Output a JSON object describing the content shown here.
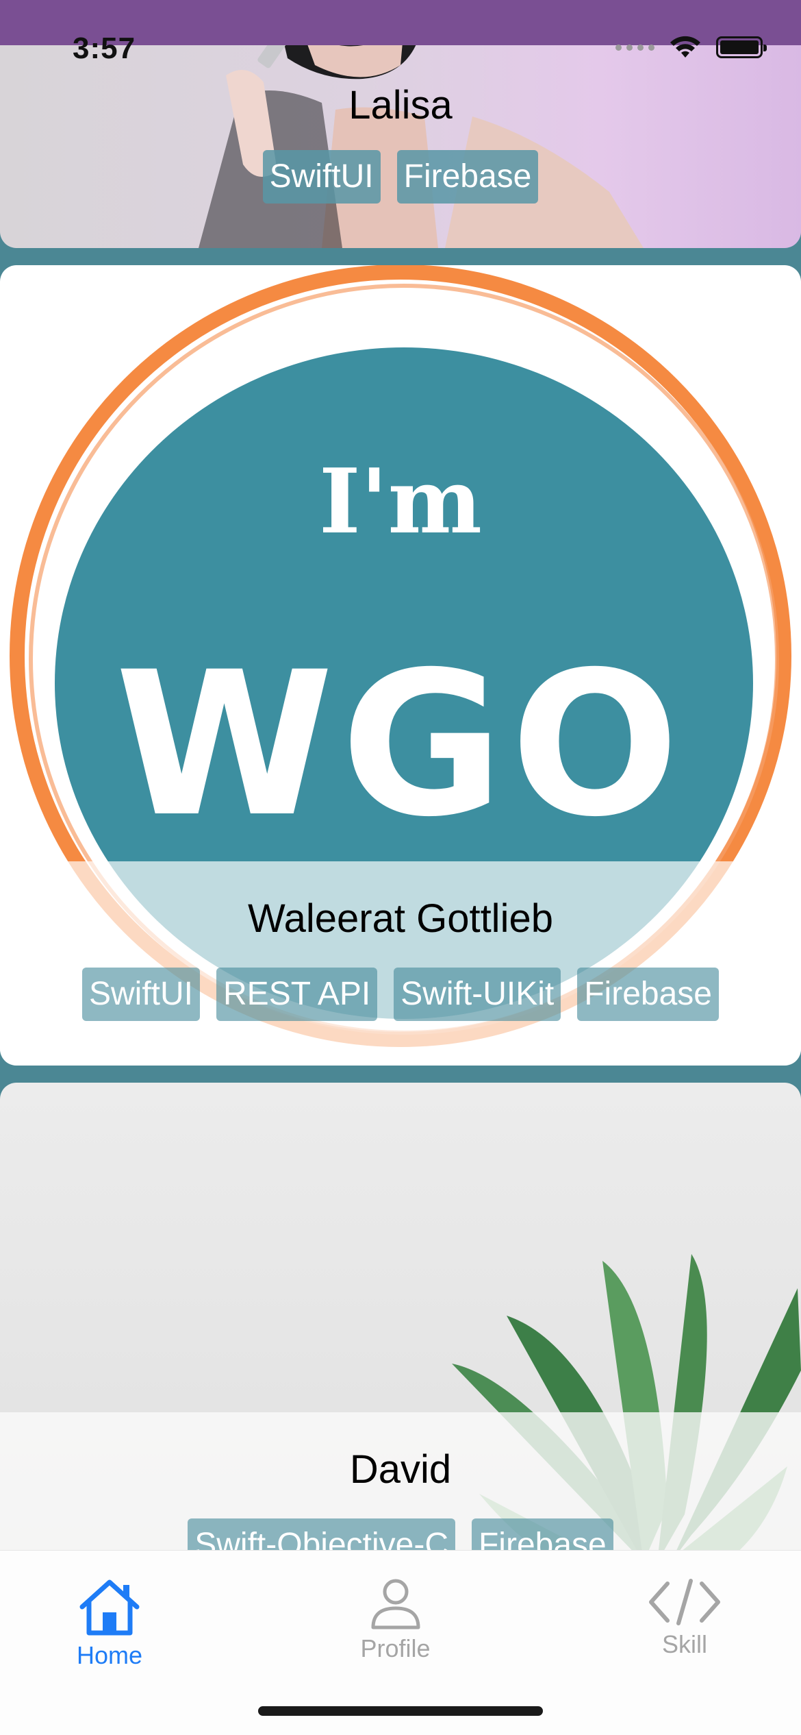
{
  "status_bar": {
    "time": "3:57"
  },
  "cards": [
    {
      "name": "Lalisa",
      "tags": [
        "SwiftUI",
        "Firebase"
      ]
    },
    {
      "name": "Waleerat Gottlieb",
      "tags": [
        "SwiftUI",
        "REST API",
        "Swift-UIKit",
        "Firebase"
      ],
      "logo_text": {
        "line1": "I'm",
        "line2": "WGO"
      }
    },
    {
      "name": "David",
      "tags": [
        "Swift-Objective-C",
        "Firebase"
      ]
    }
  ],
  "tab_bar": {
    "items": [
      {
        "label": "Home",
        "icon": "house-icon",
        "selected": true
      },
      {
        "label": "Profile",
        "icon": "person-icon",
        "selected": false
      },
      {
        "label": "Skill",
        "icon": "code-icon",
        "selected": false
      }
    ]
  },
  "colors": {
    "accent": "#1e7cf6",
    "background": "#4b8794",
    "logo_teal": "#3d8fa0",
    "logo_ring": "#f58a42"
  }
}
